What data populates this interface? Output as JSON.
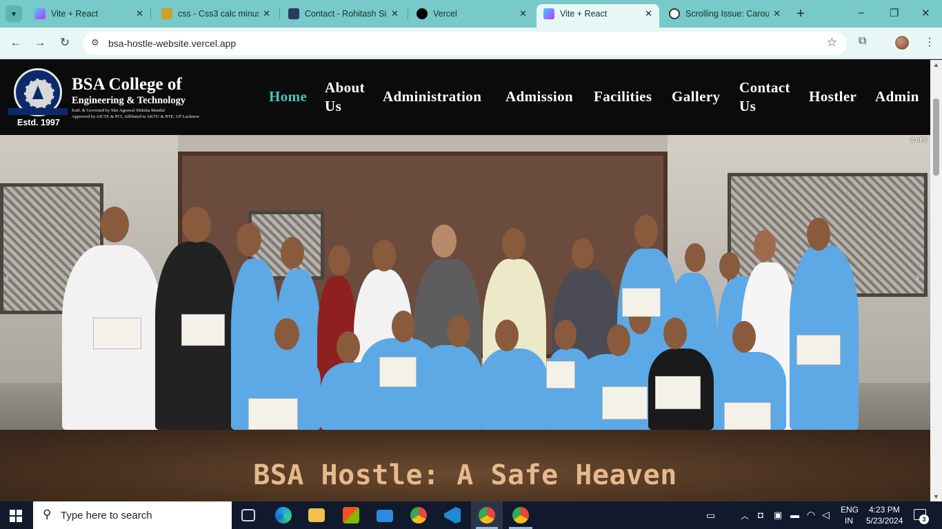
{
  "browser": {
    "tabs": [
      {
        "title": "Vite + React",
        "active": false
      },
      {
        "title": "css - Css3 calc minus",
        "active": false
      },
      {
        "title": "Contact - Rohitash Si",
        "active": false
      },
      {
        "title": "Vercel",
        "active": false
      },
      {
        "title": "Vite + React",
        "active": true
      },
      {
        "title": "Scrolling Issue: Carou",
        "active": false
      }
    ],
    "url": "bsa-hostle-website.vercel.app",
    "icons": {
      "tab_menu": "chevron-down-icon",
      "new_tab": "+",
      "minimize": "–",
      "maximize": "❐",
      "close": "✕",
      "back": "←",
      "forward": "→",
      "reload": "↻",
      "site_info": "⚙",
      "star": "☆",
      "extensions": "⧉",
      "menu": "⋮"
    }
  },
  "site": {
    "brand": {
      "title": "BSA College of",
      "subtitle": "Engineering & Technology",
      "line1": "Estd. & Governed by Shri Agrawal Shiksha Mandal",
      "line2": "Approved by AICTE & PCI, Affiliated to AKTU & BTE, UP Lucknow",
      "estd": "Estd. 1997"
    },
    "nav": [
      {
        "label": "Home",
        "active": true
      },
      {
        "label": "About Us"
      },
      {
        "label": "Administration"
      },
      {
        "label": "Admission"
      },
      {
        "label": "Facilities"
      },
      {
        "label": "Gallery"
      },
      {
        "label": "Contact Us"
      },
      {
        "label": "Hostler"
      },
      {
        "label": "Admin"
      }
    ],
    "carousel": {
      "counter": "2 of 5",
      "prev": "‹",
      "next": "›",
      "current_slide": 2,
      "total_slides": 5
    },
    "section_title": "BSA Hostle: A Safe Heaven",
    "colors": {
      "nav_active": "#48c6b8",
      "section_title": "#e6b98c"
    }
  },
  "taskbar": {
    "search_placeholder": "Type here to search",
    "language": "ENG",
    "region": "IN",
    "time": "4:23 PM",
    "date": "5/23/2024",
    "notifications": "3",
    "apps": [
      "task-view-icon",
      "edge-icon",
      "file-explorer-icon",
      "store-icon",
      "mail-icon",
      "chrome-icon",
      "vscode-icon",
      "chrome-profile-icon",
      "chrome-profile-icon"
    ]
  }
}
